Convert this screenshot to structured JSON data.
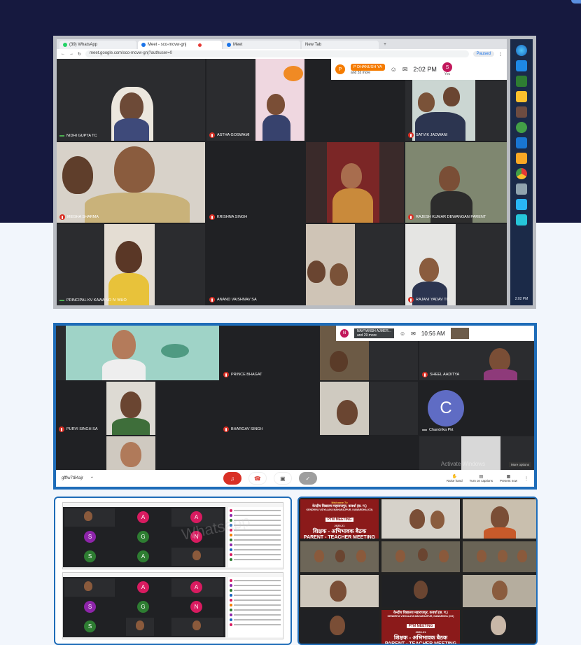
{
  "panel1": {
    "tabs": [
      "(39) WhatsApp",
      "Meet - sco-mcvw-gnj",
      "Meet",
      "New Tab"
    ],
    "url": "meet.google.com/sco-mcvw-gnj?authuser=0",
    "paused_label": "Paused",
    "presenter_initial": "P",
    "presenter_name": "P DHANUSH YA",
    "presenter_more": "and 32 more",
    "time": "2:02 PM",
    "you_initial": "S",
    "you_label": "You",
    "participants": [
      "NIDHI GUPTA TC",
      "ASTHA GOSWAMI",
      "SATVIK JADWANI",
      "MEGHA SHARMA",
      "KRISHNA SINGH",
      "RAJESH KUMAR DEWANGAN PARENT",
      "PRINCIPAL KV KAWA NO IV WHO",
      "ANAND VAISHNAV SA",
      "RAJANI YADAV TC"
    ],
    "taskbar_time": "2:02 PM"
  },
  "panel2": {
    "presenter_initial": "N",
    "presenter_name": "NAVYANSH AJMER...",
    "presenter_more": "and 29 more",
    "time": "10:56 AM",
    "participants": [
      "PRINCE BHAGAT",
      "SHEEL AADITYA",
      "PURVI SINGH SA",
      "BHARGAV SINGH",
      "Chandrika Pkt"
    ],
    "c_initial": "C",
    "meeting_code": "gfffw7t84ajr",
    "activate": "Activate Windows",
    "more_options": "More options",
    "raise_hand": "Raise hand",
    "turn_on_captions": "Turn on captions",
    "present_now": "Present now"
  },
  "panel3": {
    "letters_top": [
      "A",
      "A",
      "S",
      "G",
      "N",
      "S",
      "A"
    ],
    "letters_bottom": [
      "A",
      "A",
      "S",
      "G",
      "N",
      "S"
    ],
    "watermark": "Whatsapp"
  },
  "panel4": {
    "welcome": "Welcome To",
    "kv_hindi": "केन्द्रीय विद्यालय महाराजपुर, कवर्धा (छ. ग.)",
    "kv_english": "KENDRIYA VIDYALAYA MAHARAJPUR, KAWARDHA (CG)",
    "ptm": "PTM MEETING",
    "year": "2020-21",
    "hindi_title": "शिक्षक - अभिभावक बैठक",
    "english_title": "PARENT - TEACHER MEETING"
  },
  "colors": {
    "top_band": "#16193f",
    "frame_blue": "#1e6cb8",
    "meet_dark": "#202124",
    "mic_red": "#d93025",
    "banner_red": "#8b1a1a"
  }
}
